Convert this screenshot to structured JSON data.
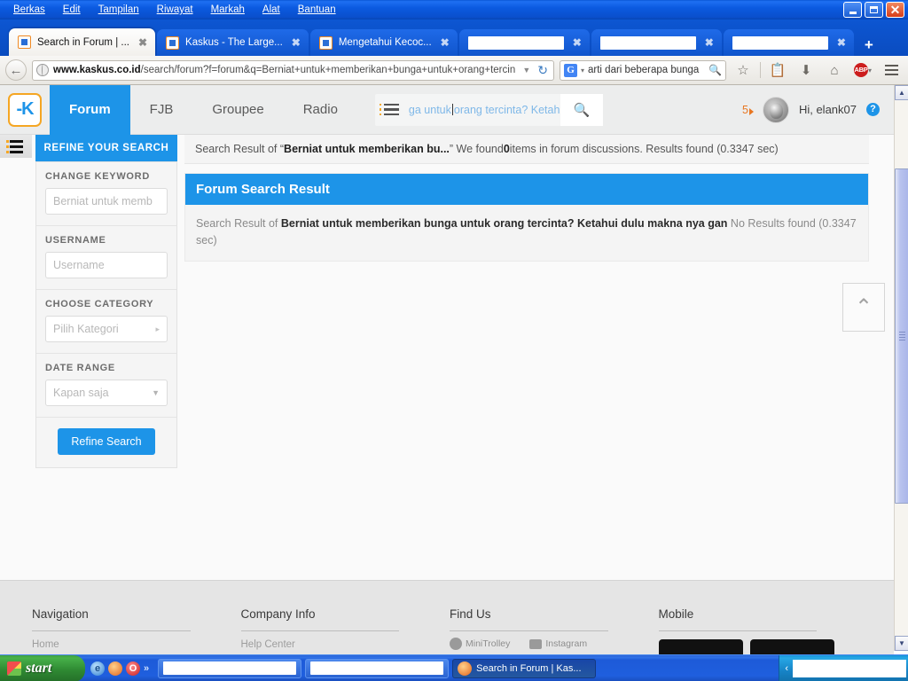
{
  "os": {
    "window_controls": {
      "minimize": "_",
      "maximize": "❐",
      "close": "✕"
    },
    "taskbar": {
      "start_label": "start",
      "quick_launch": [
        "internet-explorer",
        "firefox",
        "opera"
      ],
      "quick_launch_more": "»",
      "tasks": [
        {
          "title": "",
          "redacted": true,
          "active": false
        },
        {
          "title": "",
          "redacted": true,
          "active": false
        },
        {
          "title": "Search in Forum | Kas...",
          "redacted": false,
          "active": true
        }
      ],
      "tray_toggle": "‹"
    }
  },
  "browser": {
    "menu": [
      "Berkas",
      "Edit",
      "Tampilan",
      "Riwayat",
      "Markah",
      "Alat",
      "Bantuan"
    ],
    "tabs": [
      {
        "title": "Search in Forum | ...",
        "active": true,
        "redacted": false
      },
      {
        "title": "Kaskus - The Large...",
        "active": false,
        "redacted": false
      },
      {
        "title": "Mengetahui Kecoc...",
        "active": false,
        "redacted": false
      },
      {
        "title": "",
        "active": false,
        "redacted": true
      },
      {
        "title": "",
        "active": false,
        "redacted": true
      },
      {
        "title": "",
        "active": false,
        "redacted": true
      }
    ],
    "new_tab_label": "+",
    "close_tab_label": "✖",
    "back_label": "←",
    "url": {
      "domain": "www.kaskus.co.id",
      "path": "/search/forum?f=forum&q=Berniat+untuk+memberikan+bunga+untuk+orang+tercin",
      "dropdown": "▼",
      "reload": "↻"
    },
    "search": {
      "engine": "G",
      "engine_caret": "▾",
      "query": "arti dari beberapa bunga",
      "go_icon": "magnifier-icon"
    },
    "toolbar_icons": [
      "bookmark-star-icon",
      "library-icon",
      "downloads-icon",
      "home-icon",
      "adblock-plus-icon",
      "menu-hamburger-icon"
    ],
    "adblock_label": "ABP"
  },
  "site": {
    "logo_text": "-K",
    "nav": [
      {
        "label": "Forum",
        "active": true
      },
      {
        "label": "FJB",
        "active": false
      },
      {
        "label": "Groupee",
        "active": false
      },
      {
        "label": "Radio",
        "active": false
      }
    ],
    "header_search": {
      "value_visible": "ga untuk",
      "value_rest": "orang tercinta? Ketahu",
      "go_icon": "search-icon"
    },
    "notification_count": "5",
    "greeting": "Hi, elank07",
    "help_icon": "?",
    "left_rail_icon": "list-menu-icon"
  },
  "sidebar": {
    "title": "REFINE YOUR SEARCH",
    "sections": [
      {
        "label": "CHANGE KEYWORD",
        "value": "Berniat untuk memb",
        "type": "text"
      },
      {
        "label": "USERNAME",
        "value": "Username",
        "type": "text"
      },
      {
        "label": "CHOOSE CATEGORY",
        "value": "Pilih Kategori",
        "type": "flyout",
        "caret": "▸"
      },
      {
        "label": "DATE RANGE",
        "value": "Kapan saja",
        "type": "dropdown",
        "caret": "▼"
      }
    ],
    "submit_label": "Refine Search"
  },
  "results": {
    "summary_prefix": "Search Result of “",
    "summary_query": "Berniat untuk memberikan bu...",
    "summary_mid": "” We found ",
    "summary_count": "0",
    "summary_suffix": " items in forum discussions. Results found (0.3347 sec)",
    "card_title": "Forum Search Result",
    "body_prefix": "Search Result of ",
    "body_query": "Berniat untuk memberikan bunga untuk orang tercinta? Ketahui dulu makna nya gan",
    "body_suffix": " No Results found (0.3347 sec)",
    "scroll_top_icon": "⌃"
  },
  "footer": {
    "columns": [
      {
        "title": "Navigation",
        "stub": "Home"
      },
      {
        "title": "Company Info",
        "stub": "Help Center"
      },
      {
        "title": "Find Us",
        "stub": ""
      },
      {
        "title": "Mobile",
        "stub": ""
      }
    ],
    "find_us": [
      "MiniTrolley",
      "Instagram"
    ]
  },
  "scrollbars": {
    "v_up": "▲",
    "v_down": "▼",
    "h_left": "◀",
    "h_right": "▶"
  },
  "colors": {
    "accent": "#1d94e8",
    "logo_border": "#f5a623",
    "badge": "#e87722",
    "xp_blue": "#0b4cc4"
  }
}
